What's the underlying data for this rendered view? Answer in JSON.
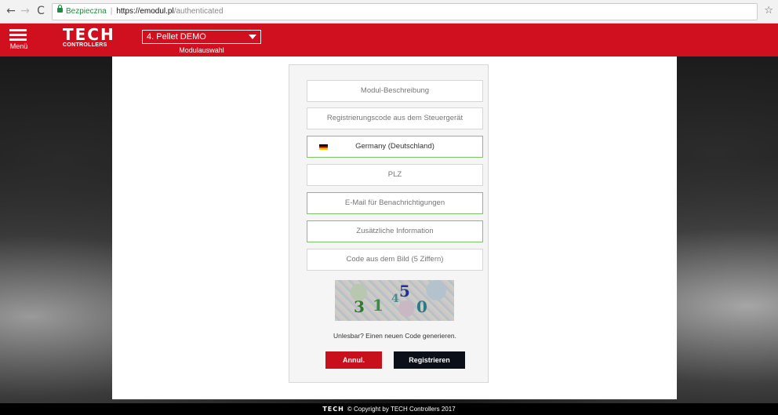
{
  "browser": {
    "secure_label": "Bezpieczna",
    "url_host": "https://emodul.pl",
    "url_path": "/authenticated"
  },
  "header": {
    "menu_label": "Menü",
    "logo_main": "TECH",
    "logo_sub": "CONTROLLERS",
    "module_selected": "4. Pellet DEMO",
    "module_label": "Modulauswahl",
    "accent_color": "#d0101e"
  },
  "form": {
    "fields": [
      {
        "placeholder": "Modul-Beschreibung"
      },
      {
        "placeholder": "Registrierungscode aus dem Steuergerät"
      },
      {
        "value": "Germany (Deutschland)"
      },
      {
        "placeholder": "PLZ"
      },
      {
        "placeholder": "E-Mail für Benachrichtigungen"
      },
      {
        "placeholder": "Zusätzliche Information"
      },
      {
        "placeholder": "Code aus dem Bild (5 Ziffern)"
      }
    ],
    "captcha_chars": [
      "3",
      "1",
      "4",
      "5",
      "0"
    ],
    "regenerate_link": "Unlesbar? Einen neuen Code generieren.",
    "cancel_label": "Annul.",
    "register_label": "Registrieren"
  },
  "footer": {
    "logo": "TECH",
    "copyright": "© Copyright by TECH Controllers 2017"
  }
}
